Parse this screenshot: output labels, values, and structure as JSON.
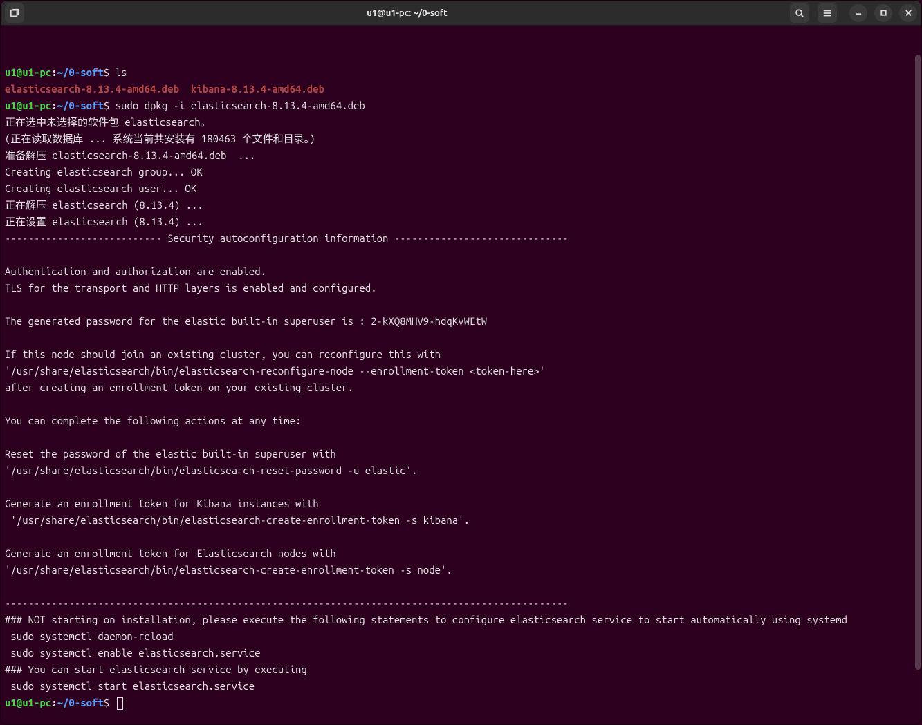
{
  "titlebar": {
    "title": "u1@u1-pc: ~/0-soft",
    "newtab_icon": "new-tab-icon",
    "search_icon": "search-icon",
    "menu_icon": "hamburger-icon",
    "min_icon": "minimize-icon",
    "max_icon": "maximize-icon",
    "close_icon": "close-icon"
  },
  "prompt": {
    "user": "u1@u1-pc",
    "sep": ":",
    "path": "~/0-soft",
    "symbol": "$"
  },
  "lines": [
    {
      "type": "prompt",
      "cmd": "ls"
    },
    {
      "type": "filelist",
      "items": [
        "elasticsearch-8.13.4-amd64.deb",
        "  ",
        "kibana-8.13.4-amd64.deb"
      ]
    },
    {
      "type": "prompt",
      "cmd": "sudo dpkg -i elasticsearch-8.13.4-amd64.deb"
    },
    {
      "type": "plain",
      "text": "正在选中未选择的软件包 elasticsearch。"
    },
    {
      "type": "plain",
      "text": "(正在读取数据库 ... 系统当前共安装有 180463 个文件和目录。)"
    },
    {
      "type": "plain",
      "text": "准备解压 elasticsearch-8.13.4-amd64.deb  ..."
    },
    {
      "type": "plain",
      "text": "Creating elasticsearch group... OK"
    },
    {
      "type": "plain",
      "text": "Creating elasticsearch user... OK"
    },
    {
      "type": "plain",
      "text": "正在解压 elasticsearch (8.13.4) ..."
    },
    {
      "type": "plain",
      "text": "正在设置 elasticsearch (8.13.4) ..."
    },
    {
      "type": "plain",
      "text": "--------------------------- Security autoconfiguration information ------------------------------"
    },
    {
      "type": "plain",
      "text": ""
    },
    {
      "type": "plain",
      "text": "Authentication and authorization are enabled."
    },
    {
      "type": "plain",
      "text": "TLS for the transport and HTTP layers is enabled and configured."
    },
    {
      "type": "plain",
      "text": ""
    },
    {
      "type": "plain",
      "text": "The generated password for the elastic built-in superuser is : 2-kXQ8MHV9-hdqKvWEtW"
    },
    {
      "type": "plain",
      "text": ""
    },
    {
      "type": "plain",
      "text": "If this node should join an existing cluster, you can reconfigure this with"
    },
    {
      "type": "plain",
      "text": "'/usr/share/elasticsearch/bin/elasticsearch-reconfigure-node --enrollment-token <token-here>'"
    },
    {
      "type": "plain",
      "text": "after creating an enrollment token on your existing cluster."
    },
    {
      "type": "plain",
      "text": ""
    },
    {
      "type": "plain",
      "text": "You can complete the following actions at any time:"
    },
    {
      "type": "plain",
      "text": ""
    },
    {
      "type": "plain",
      "text": "Reset the password of the elastic built-in superuser with"
    },
    {
      "type": "plain",
      "text": "'/usr/share/elasticsearch/bin/elasticsearch-reset-password -u elastic'."
    },
    {
      "type": "plain",
      "text": ""
    },
    {
      "type": "plain",
      "text": "Generate an enrollment token for Kibana instances with"
    },
    {
      "type": "plain",
      "text": " '/usr/share/elasticsearch/bin/elasticsearch-create-enrollment-token -s kibana'."
    },
    {
      "type": "plain",
      "text": ""
    },
    {
      "type": "plain",
      "text": "Generate an enrollment token for Elasticsearch nodes with"
    },
    {
      "type": "plain",
      "text": "'/usr/share/elasticsearch/bin/elasticsearch-create-enrollment-token -s node'."
    },
    {
      "type": "plain",
      "text": ""
    },
    {
      "type": "plain",
      "text": "-------------------------------------------------------------------------------------------------"
    },
    {
      "type": "plain",
      "text": "### NOT starting on installation, please execute the following statements to configure elasticsearch service to start automatically using systemd"
    },
    {
      "type": "plain",
      "text": " sudo systemctl daemon-reload"
    },
    {
      "type": "plain",
      "text": " sudo systemctl enable elasticsearch.service"
    },
    {
      "type": "plain",
      "text": "### You can start elasticsearch service by executing"
    },
    {
      "type": "plain",
      "text": " sudo systemctl start elasticsearch.service"
    },
    {
      "type": "prompt-cursor",
      "cmd": ""
    }
  ]
}
